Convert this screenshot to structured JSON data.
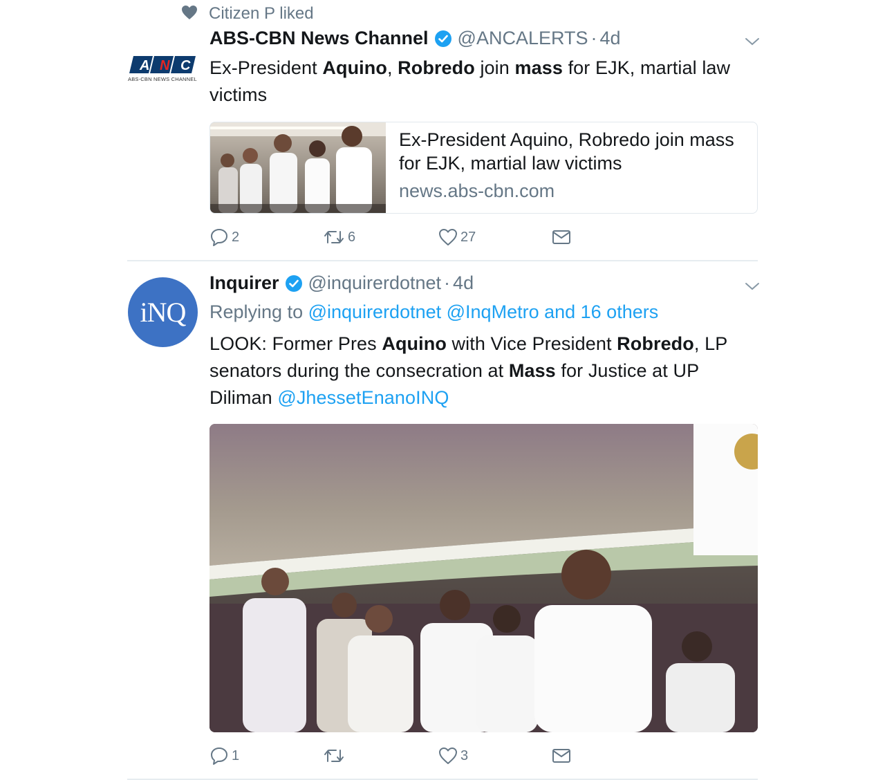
{
  "social_context": {
    "text": "Citizen P liked"
  },
  "tweets": [
    {
      "avatar": {
        "brand": "ANC",
        "sub": "ABS-CBN NEWS CHANNEL"
      },
      "name": "ABS-CBN News Channel",
      "handle": "@ANCALERTS",
      "time": "4d",
      "text": [
        {
          "t": "Ex-President "
        },
        {
          "t": "Aquino",
          "b": true
        },
        {
          "t": ", "
        },
        {
          "t": "Robredo",
          "b": true
        },
        {
          "t": " join "
        },
        {
          "t": "mass",
          "b": true
        },
        {
          "t": " for EJK, martial law victims"
        }
      ],
      "card": {
        "title": "Ex-President Aquino, Robredo join mass for EJK, martial law victims",
        "domain": "news.abs-cbn.com"
      },
      "actions": {
        "replies": "2",
        "retweets": "6",
        "likes": "27"
      }
    },
    {
      "avatar": {
        "brand": "iNQ"
      },
      "name": "Inquirer",
      "handle": "@inquirerdotnet",
      "time": "4d",
      "replying": {
        "prefix": "Replying to",
        "targets": "@inquirerdotnet @InqMetro and 16 others"
      },
      "text": [
        {
          "t": "LOOK: Former Pres "
        },
        {
          "t": "Aquino",
          "b": true
        },
        {
          "t": " with Vice President "
        },
        {
          "t": "Robredo",
          "b": true
        },
        {
          "t": ", LP senators during the consecration at "
        },
        {
          "t": "Mass",
          "b": true
        },
        {
          "t": " for Justice at UP Diliman "
        },
        {
          "t": "@JhessetEnanoINQ",
          "link": true
        }
      ],
      "actions": {
        "replies": "1",
        "retweets": "",
        "likes": "3"
      }
    }
  ],
  "colors": {
    "accent": "#1da1f2",
    "muted": "#657786",
    "verified": "#1da1f2",
    "divider": "#e6ecf0"
  }
}
